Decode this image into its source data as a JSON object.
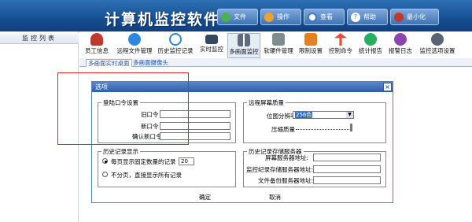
{
  "app": {
    "title": "计算机监控软件"
  },
  "header_buttons": [
    {
      "label": "文件",
      "icon": "file-icon",
      "color": "#4caf50"
    },
    {
      "label": "操作",
      "icon": "tools-icon",
      "color": "#f0a030"
    },
    {
      "label": "查看",
      "icon": "view-icon",
      "color": "#3a78c8"
    },
    {
      "label": "帮助",
      "icon": "help-icon",
      "color": "#3a78c8"
    },
    {
      "label": "最小化",
      "icon": "minimize-icon",
      "color": "#c0392b"
    }
  ],
  "sidebar": {
    "title": "监控列表"
  },
  "toolbar": [
    {
      "label": "员工信息",
      "icon": "employee-icon",
      "color": "#c0392b"
    },
    {
      "label": "远程文件管理",
      "icon": "globe-icon",
      "color": "#2e86de"
    },
    {
      "label": "历史监控记录",
      "icon": "search-history-icon",
      "color": "#2e86de"
    },
    {
      "label": "实时监控",
      "icon": "monitor-icon",
      "color": "#34495e"
    },
    {
      "label": "多画面监控",
      "icon": "multi-screen-icon",
      "color": "#5d6d7e"
    },
    {
      "label": "软硬件管理",
      "icon": "software-icon",
      "color": "#7f8c8d"
    },
    {
      "label": "限制设置",
      "icon": "restrict-icon",
      "color": "#e67e22"
    },
    {
      "label": "控制命令",
      "icon": "control-icon",
      "color": "#e74c3c"
    },
    {
      "label": "统计报告",
      "icon": "report-icon",
      "color": "#27ae60"
    },
    {
      "label": "报警日志",
      "icon": "alarm-log-icon",
      "color": "#8e44ad"
    },
    {
      "label": "监控选项设置",
      "icon": "options-gear-icon",
      "color": "#566573"
    }
  ],
  "subtabs": [
    {
      "label": "多画面实时桌面"
    },
    {
      "label": "多画面摄像头"
    }
  ],
  "dialog": {
    "title": "选项",
    "close": "×",
    "login": {
      "legend": "登陆口令设置",
      "old_label": "旧口令",
      "new_label": "新口令",
      "confirm_label": "确认新口令"
    },
    "remote": {
      "legend": "远程屏幕质量",
      "resolution_label": "位图分辨率",
      "resolution_value": "256色",
      "quality_label": "压缩质量"
    },
    "history": {
      "legend": "历史记录显示",
      "opt1": "每页显示固定数量的记录",
      "opt1_value": "20",
      "opt2": "不分页，直接显示所有记录"
    },
    "server": {
      "legend": "历史记录存储服务器",
      "screen_label": "屏幕服务器地址:",
      "monitor_label": "监控纪录存储服务器地址:",
      "file_label": "文件备份服务器地址:"
    },
    "ok": "确定",
    "cancel": "取消"
  }
}
